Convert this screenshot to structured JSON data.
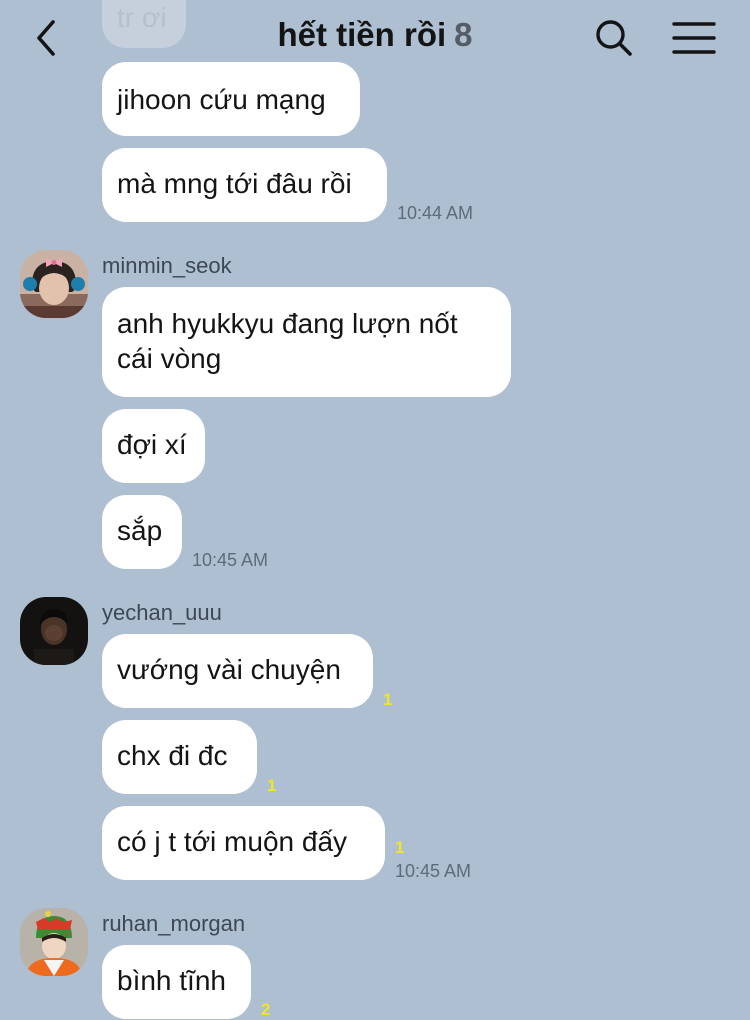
{
  "header": {
    "title": "hết tiền rồi",
    "member_count": "8",
    "back_icon": "chevron-left-icon",
    "search_icon": "search-icon",
    "menu_icon": "hamburger-menu-icon"
  },
  "colors": {
    "background": "#aebfd2",
    "bubble": "#ffffff",
    "unread": "#f2e427"
  },
  "messages_top": {
    "partial_text": "tr ơi",
    "bubble1": "jihoon cứu mạng",
    "bubble2": "mà mng tới đâu rồi",
    "time": "10:44 AM"
  },
  "groups": [
    {
      "sender": "minmin_seok",
      "avatar": "avatar-minmin",
      "bubbles": [
        "anh hyukkyu đang lượn nốt",
        "cái vòng",
        "đợi xí",
        "sắp"
      ],
      "time": "10:45 AM"
    },
    {
      "sender": "yechan_uuu",
      "avatar": "avatar-yechan",
      "bubbles": [
        "vướng vài chuyện",
        "chx đi đc",
        "có j t tới muộn đấy"
      ],
      "unread": [
        "1",
        "1",
        "1"
      ],
      "time": "10:45 AM"
    },
    {
      "sender": "ruhan_morgan",
      "avatar": "avatar-ruhan",
      "bubbles": [
        "bình tĩnh"
      ],
      "unread": [
        "2"
      ]
    }
  ]
}
